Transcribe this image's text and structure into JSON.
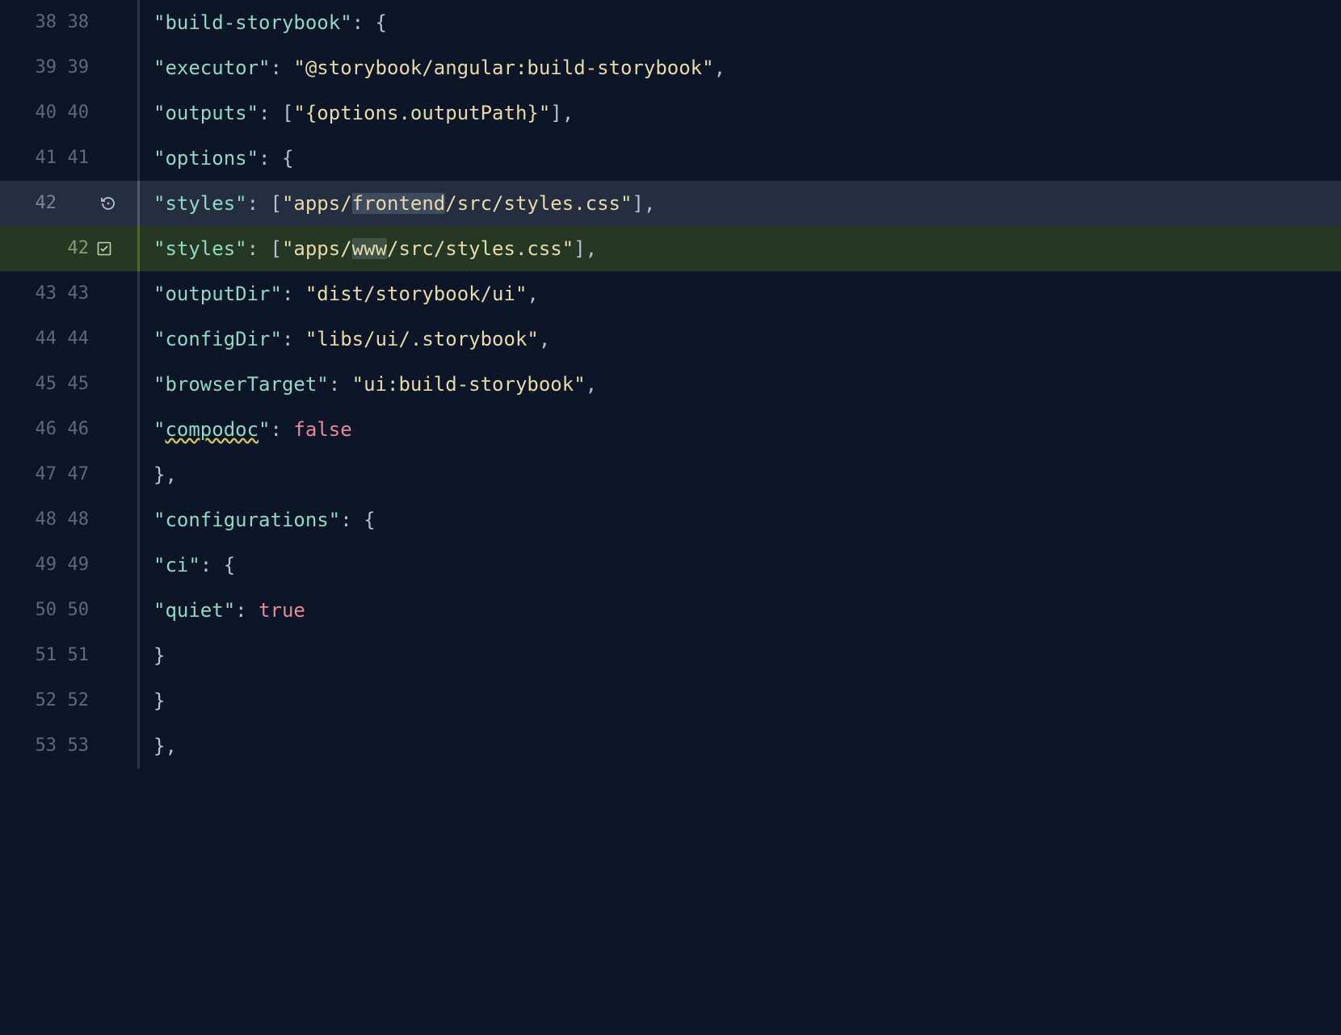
{
  "lines": [
    {
      "left": "38",
      "right": "38"
    },
    {
      "left": "39",
      "right": "39"
    },
    {
      "left": "40",
      "right": "40"
    },
    {
      "left": "41",
      "right": "41"
    },
    {
      "left": "42",
      "right": ""
    },
    {
      "left": "",
      "right": "42"
    },
    {
      "left": "43",
      "right": "43"
    },
    {
      "left": "44",
      "right": "44"
    },
    {
      "left": "45",
      "right": "45"
    },
    {
      "left": "46",
      "right": "46"
    },
    {
      "left": "47",
      "right": "47"
    },
    {
      "left": "48",
      "right": "48"
    },
    {
      "left": "49",
      "right": "49"
    },
    {
      "left": "50",
      "right": "50"
    },
    {
      "left": "51",
      "right": "51"
    },
    {
      "left": "52",
      "right": "52"
    },
    {
      "left": "53",
      "right": "53"
    }
  ],
  "code": {
    "build_storybook_key": "\"build-storybook\"",
    "executor_key": "\"executor\"",
    "executor_val": "\"@storybook/angular:build-storybook\"",
    "outputs_key": "\"outputs\"",
    "outputs_val": "\"{options.outputPath}\"",
    "options_key": "\"options\"",
    "styles_key": "\"styles\"",
    "styles_del_pre": "\"apps/",
    "styles_del_hl": "frontend",
    "styles_del_post": "/src/styles.css\"",
    "styles_add_pre": "\"apps/",
    "styles_add_hl": "www",
    "styles_add_post": "/src/styles.css\"",
    "outputdir_key": "\"outputDir\"",
    "outputdir_val": "\"dist/storybook/ui\"",
    "configdir_key": "\"configDir\"",
    "configdir_val": "\"libs/ui/.storybook\"",
    "browsertarget_key": "\"browserTarget\"",
    "browsertarget_val": "\"ui:build-storybook\"",
    "compodoc_key": "\"",
    "compodoc_word": "compodoc",
    "compodoc_key_end": "\"",
    "compodoc_val": "false",
    "configurations_key": "\"configurations\"",
    "ci_key": "\"ci\"",
    "quiet_key": "\"quiet\"",
    "quiet_val": "true"
  }
}
